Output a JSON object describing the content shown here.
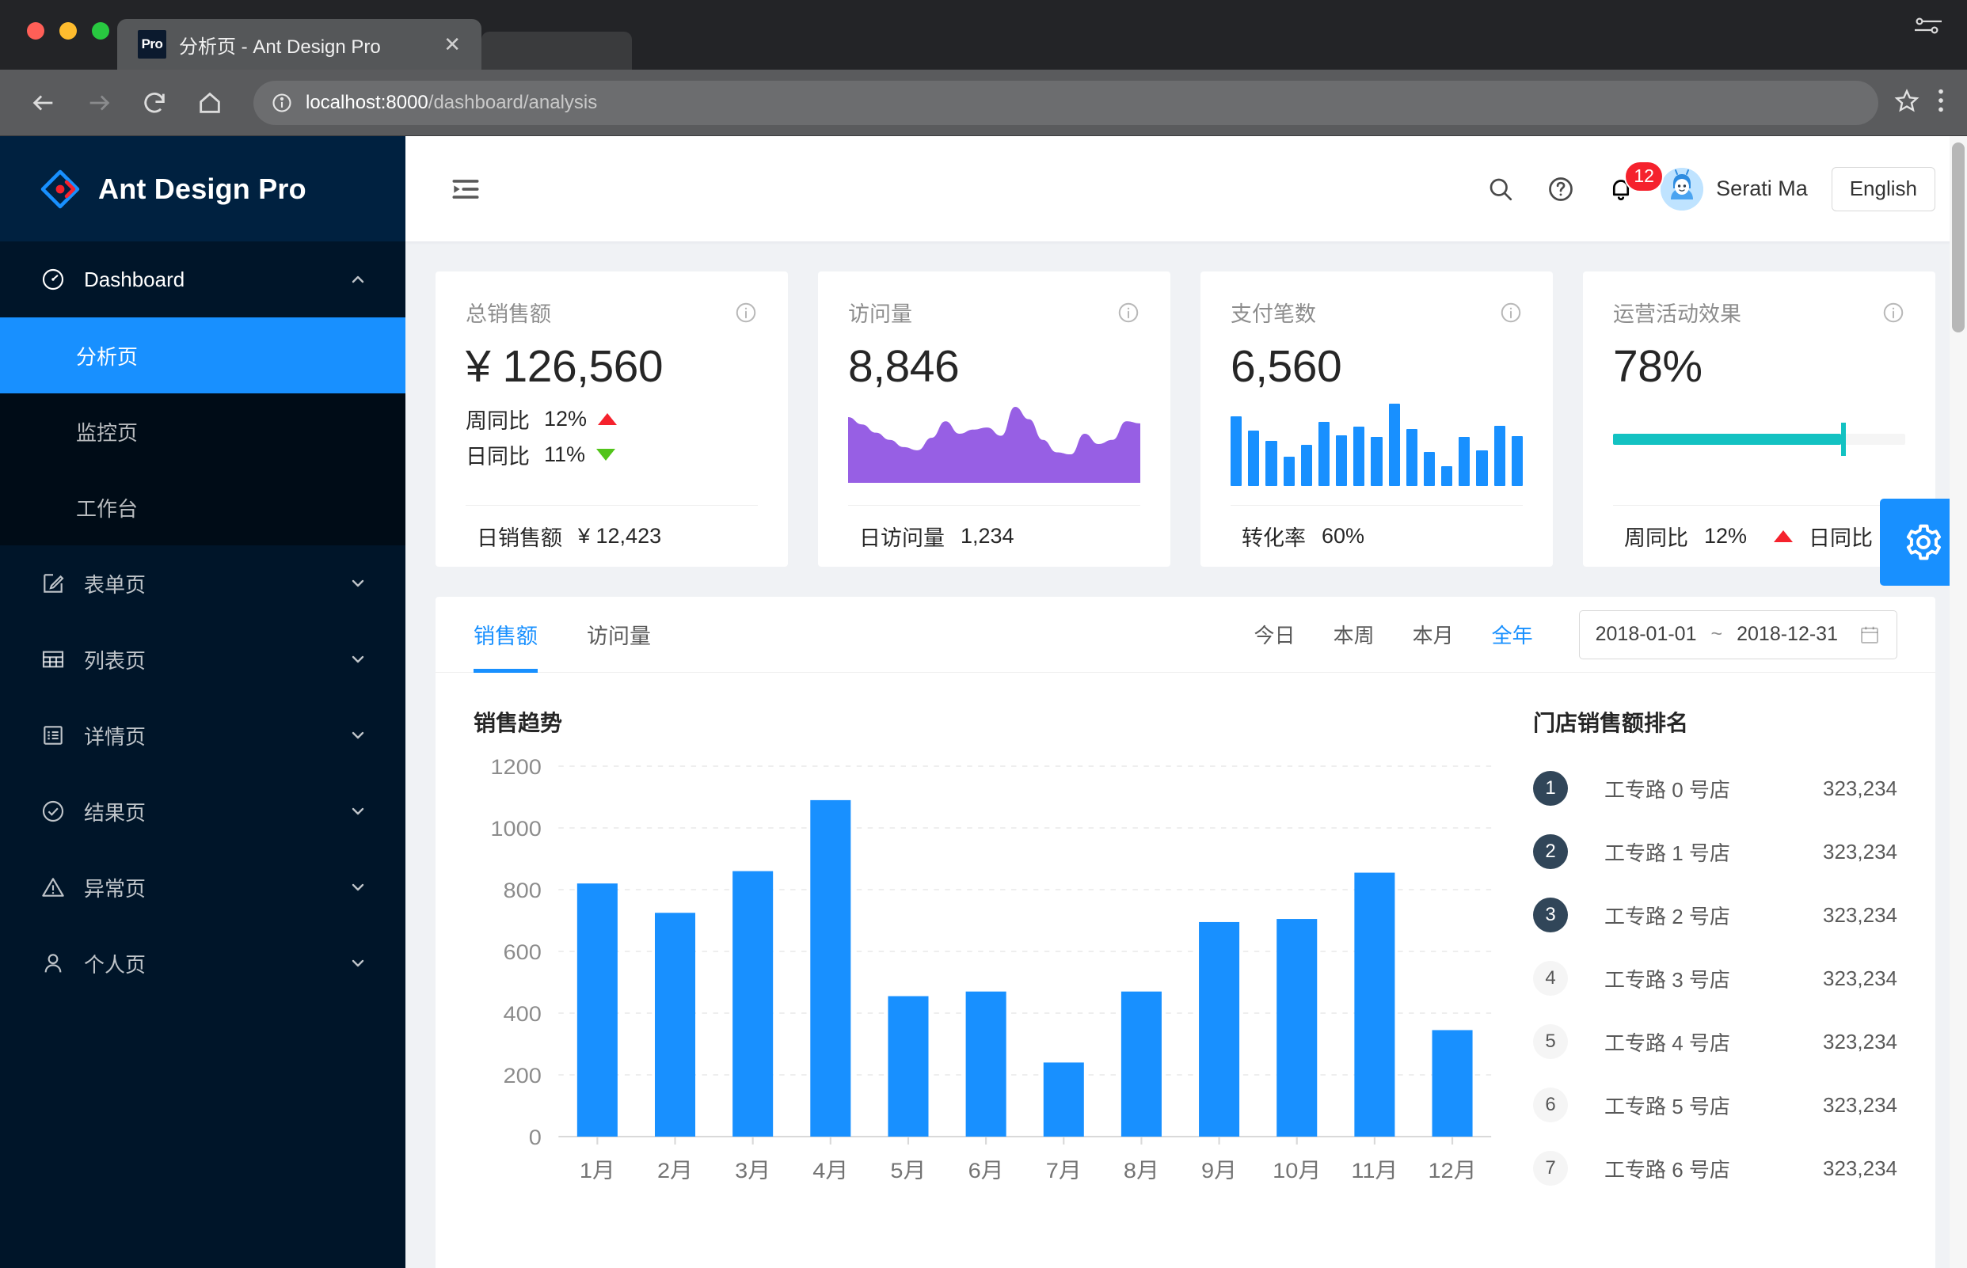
{
  "browser": {
    "tab_favicon_label": "Pro",
    "tab_title": "分析页 - Ant Design Pro",
    "url_host": "localhost:8000",
    "url_path": "/dashboard/analysis"
  },
  "sidebar": {
    "logo_text": "Ant Design Pro",
    "items": [
      {
        "label": "Dashboard",
        "icon": "dashboard-icon",
        "expanded": true
      },
      {
        "label": "表单页",
        "icon": "form-icon",
        "expanded": false
      },
      {
        "label": "列表页",
        "icon": "table-icon",
        "expanded": false
      },
      {
        "label": "详情页",
        "icon": "profile-icon",
        "expanded": false
      },
      {
        "label": "结果页",
        "icon": "check-circle-icon",
        "expanded": false
      },
      {
        "label": "异常页",
        "icon": "warning-icon",
        "expanded": false
      },
      {
        "label": "个人页",
        "icon": "user-icon",
        "expanded": false
      }
    ],
    "submenu": [
      {
        "label": "分析页",
        "active": true
      },
      {
        "label": "监控页",
        "active": false
      },
      {
        "label": "工作台",
        "active": false
      }
    ]
  },
  "header": {
    "fold_icon": "menu-fold-icon",
    "search_icon": "search-icon",
    "help_icon": "question-circle-icon",
    "bell_icon": "bell-icon",
    "notification_count": "12",
    "user_name": "Serati Ma",
    "lang_label": "English"
  },
  "stat_cards": [
    {
      "title": "总销售额",
      "value": "¥ 126,560",
      "trends": [
        {
          "label": "周同比",
          "value": "12%",
          "dir": "up"
        },
        {
          "label": "日同比",
          "value": "11%",
          "dir": "down"
        }
      ],
      "footer_label": "日销售额",
      "footer_value": "¥ 12,423",
      "visual": "trends"
    },
    {
      "title": "访问量",
      "value": "8,846",
      "footer_label": "日访问量",
      "footer_value": "1,234",
      "visual": "area",
      "area_color": "#975FE4"
    },
    {
      "title": "支付笔数",
      "value": "6,560",
      "footer_label": "转化率",
      "footer_value": "60%",
      "visual": "bars",
      "bar_color": "#1890FF"
    },
    {
      "title": "运营活动效果",
      "value": "78%",
      "footer_label": "周同比",
      "footer_value": "12%",
      "footer_label2": "日同比",
      "visual": "progress",
      "progress_percent": 78,
      "progress_color": "#13C2C2"
    }
  ],
  "panel": {
    "tabs": [
      {
        "label": "销售额",
        "active": true
      },
      {
        "label": "访问量",
        "active": false
      }
    ],
    "ranges": [
      {
        "label": "今日",
        "active": false
      },
      {
        "label": "本周",
        "active": false
      },
      {
        "label": "本月",
        "active": false
      },
      {
        "label": "全年",
        "active": true
      }
    ],
    "date_start": "2018-01-01",
    "date_sep": "~",
    "date_end": "2018-12-31",
    "calendar_icon": "calendar-icon",
    "chart_title": "销售趋势",
    "rank_title": "门店销售额排名",
    "ranks": [
      {
        "no": "1",
        "name": "工专路 0 号店",
        "value": "323,234"
      },
      {
        "no": "2",
        "name": "工专路 1 号店",
        "value": "323,234"
      },
      {
        "no": "3",
        "name": "工专路 2 号店",
        "value": "323,234"
      },
      {
        "no": "4",
        "name": "工专路 3 号店",
        "value": "323,234"
      },
      {
        "no": "5",
        "name": "工专路 4 号店",
        "value": "323,234"
      },
      {
        "no": "6",
        "name": "工专路 5 号店",
        "value": "323,234"
      },
      {
        "no": "7",
        "name": "工专路 6 号店",
        "value": "323,234"
      }
    ]
  },
  "settings_icon": "gear-icon",
  "colors": {
    "primary": "#1890FF",
    "sider_bg": "#001529",
    "sider_logo_bg": "#002140",
    "submenu_bg": "#000C17",
    "page_bg": "#F0F2F5",
    "up": "#F5222D",
    "down": "#52C41A"
  },
  "chart_data": {
    "type": "bar",
    "title": "销售趋势",
    "categories": [
      "1月",
      "2月",
      "3月",
      "4月",
      "5月",
      "6月",
      "7月",
      "8月",
      "9月",
      "10月",
      "11月",
      "12月"
    ],
    "values": [
      820,
      725,
      860,
      1090,
      455,
      470,
      240,
      470,
      695,
      705,
      855,
      345
    ],
    "xlabel": "",
    "ylabel": "",
    "ylim": [
      0,
      1200
    ],
    "yticks": [
      0,
      200,
      400,
      600,
      800,
      1000,
      1200
    ],
    "grid": true,
    "bar_color": "#1890FF",
    "legend": "none"
  },
  "mini_charts": {
    "visits_area": {
      "type": "area",
      "color": "#975FE4",
      "values": [
        62,
        55,
        47,
        40,
        33,
        30,
        42,
        58,
        46,
        50,
        52,
        44,
        72,
        60,
        40,
        28,
        26,
        46,
        36,
        40,
        58,
        56
      ]
    },
    "payments_bars": {
      "type": "bar",
      "color": "#1890FF",
      "values": [
        78,
        62,
        50,
        33,
        46,
        72,
        57,
        66,
        55,
        92,
        64,
        38,
        22,
        55,
        40,
        67,
        56
      ]
    }
  }
}
